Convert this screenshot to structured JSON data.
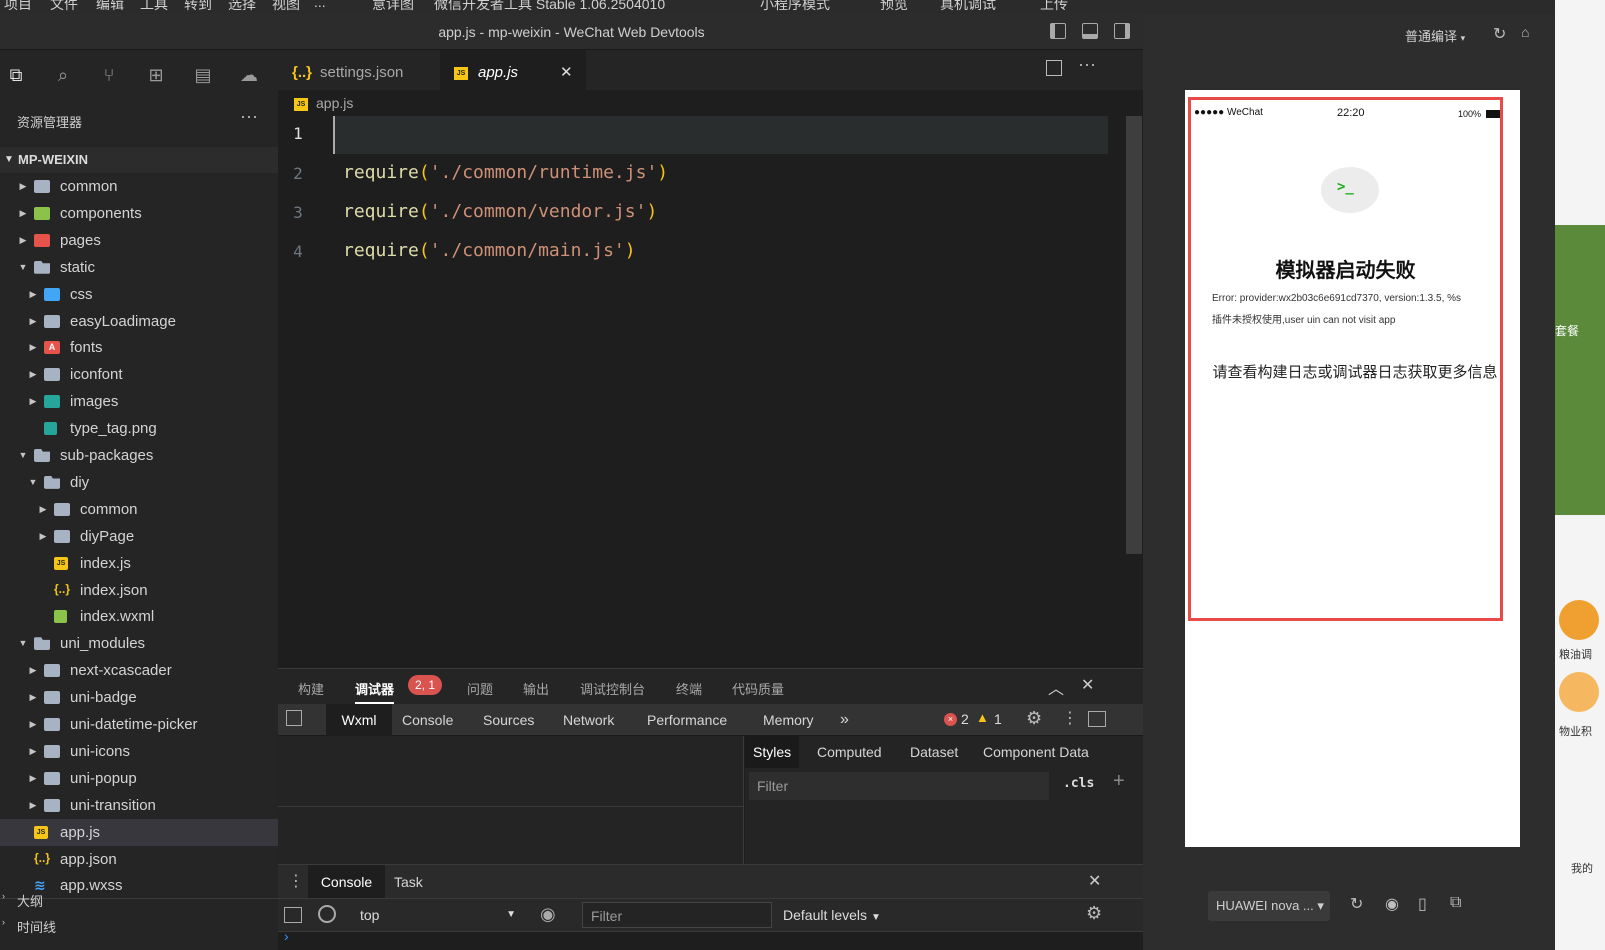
{
  "menubar": {
    "items": [
      "项目",
      "文件",
      "编辑",
      "工具",
      "转到",
      "选择",
      "视图",
      "..."
    ],
    "rest": [
      "意详图",
      "微信开发者工具 Stable 1.06.2504010",
      "小程序模式",
      "预览",
      "真机调试",
      "上传"
    ]
  },
  "window": {
    "title": "app.js - mp-weixin - WeChat Web Devtools"
  },
  "explorer": {
    "header": "资源管理器",
    "more": "···",
    "project": "MP-WEIXIN",
    "tree": [
      {
        "label": "common",
        "depth": 0,
        "type": "folder",
        "color": "folder",
        "expanded": false
      },
      {
        "label": "components",
        "depth": 0,
        "type": "folder",
        "color": "green",
        "expanded": false
      },
      {
        "label": "pages",
        "depth": 0,
        "type": "folder",
        "color": "red",
        "expanded": false
      },
      {
        "label": "static",
        "depth": 0,
        "type": "folder-open",
        "color": "folder",
        "expanded": true
      },
      {
        "label": "css",
        "depth": 1,
        "type": "folder",
        "color": "blue",
        "expanded": false
      },
      {
        "label": "easyLoadimage",
        "depth": 1,
        "type": "folder",
        "color": "folder",
        "expanded": false
      },
      {
        "label": "fonts",
        "depth": 1,
        "type": "fontsico",
        "color": "red",
        "expanded": false
      },
      {
        "label": "iconfont",
        "depth": 1,
        "type": "folder",
        "color": "folder",
        "expanded": false
      },
      {
        "label": "images",
        "depth": 1,
        "type": "folder",
        "color": "teal",
        "expanded": false
      },
      {
        "label": "type_tag.png",
        "depth": 1,
        "type": "png",
        "color": "",
        "expanded": null
      },
      {
        "label": "sub-packages",
        "depth": 0,
        "type": "folder-open",
        "color": "folder",
        "expanded": true
      },
      {
        "label": "diy",
        "depth": 1,
        "type": "folder-open",
        "color": "folder",
        "expanded": true
      },
      {
        "label": "common",
        "depth": 2,
        "type": "folder",
        "color": "folder",
        "expanded": false
      },
      {
        "label": "diyPage",
        "depth": 2,
        "type": "folder",
        "color": "folder",
        "expanded": false
      },
      {
        "label": "index.js",
        "depth": 2,
        "type": "js",
        "color": "",
        "expanded": null
      },
      {
        "label": "index.json",
        "depth": 2,
        "type": "json",
        "color": "",
        "expanded": null
      },
      {
        "label": "index.wxml",
        "depth": 2,
        "type": "wxml",
        "color": "",
        "expanded": null
      },
      {
        "label": "uni_modules",
        "depth": 0,
        "type": "folder-open",
        "color": "folder",
        "expanded": true
      },
      {
        "label": "next-xcascader",
        "depth": 1,
        "type": "folder",
        "color": "folder",
        "expanded": false
      },
      {
        "label": "uni-badge",
        "depth": 1,
        "type": "folder",
        "color": "folder",
        "expanded": false
      },
      {
        "label": "uni-datetime-picker",
        "depth": 1,
        "type": "folder",
        "color": "folder",
        "expanded": false
      },
      {
        "label": "uni-icons",
        "depth": 1,
        "type": "folder",
        "color": "folder",
        "expanded": false
      },
      {
        "label": "uni-popup",
        "depth": 1,
        "type": "folder",
        "color": "folder",
        "expanded": false
      },
      {
        "label": "uni-transition",
        "depth": 1,
        "type": "folder",
        "color": "folder",
        "expanded": false
      },
      {
        "label": "app.js",
        "depth": 0,
        "type": "js",
        "color": "",
        "expanded": null,
        "selected": true
      },
      {
        "label": "app.json",
        "depth": 0,
        "type": "json",
        "color": "",
        "expanded": null
      },
      {
        "label": "app.wxss",
        "depth": 0,
        "type": "wxss",
        "color": "",
        "expanded": null
      }
    ],
    "outline": "大纲",
    "timeline": "时间线"
  },
  "editor": {
    "tabs": [
      {
        "label": "settings.json",
        "icon": "json-icon",
        "active": false
      },
      {
        "label": "app.js",
        "icon": "js-icon",
        "active": true
      }
    ],
    "close_glyph": "✕",
    "breadcrumb": "app.js",
    "lines": [
      {
        "n": "1",
        "text": ""
      },
      {
        "n": "2",
        "fn": "require",
        "arg": "'./common/runtime.js'"
      },
      {
        "n": "3",
        "fn": "require",
        "arg": "'./common/vendor.js'"
      },
      {
        "n": "4",
        "fn": "require",
        "arg": "'./common/main.js'"
      }
    ]
  },
  "panel": {
    "tabs": [
      "构建",
      "调试器",
      "问题",
      "输出",
      "调试控制台",
      "终端",
      "代码质量"
    ],
    "active_tab": "调试器",
    "debugger_badge": "2, 1",
    "devtools_tabs": [
      "Wxml",
      "Console",
      "Sources",
      "Network",
      "Performance",
      "Memory"
    ],
    "more_tabs": "»",
    "errors": "2",
    "warnings": "1",
    "styles_tabs": [
      "Styles",
      "Computed",
      "Dataset",
      "Component Data"
    ],
    "styles_filter": "Filter",
    "cls": ".cls",
    "plus": "+",
    "console_tabs": [
      "Console",
      "Task"
    ],
    "context": "top",
    "console_filter": "Filter",
    "levels": "Default levels",
    "prompt": "›"
  },
  "simulator": {
    "toolbar_label": "普通编译",
    "status": {
      "carrier": "●●●●● WeChat",
      "time": "22:20",
      "battery": "100%"
    },
    "error_icon": ">_",
    "title": "模拟器启动失败",
    "error_line1": "Error: provider:wx2b03c6e691cd7370, version:1.3.5, %s",
    "error_line2": "插件未授权使用,user uin can not visit app",
    "more_info": "请查看构建日志或调试器日志获取更多信息",
    "device": "HUAWEI nova ...",
    "device_caret": "▾"
  },
  "right_strip": {
    "texts": [
      "套餐",
      "粮油调",
      "物业积",
      "我的"
    ]
  },
  "colors": {
    "accent_error": "#d9534f",
    "highlight_box": "#e84a4a",
    "success_green": "#1aad19"
  }
}
